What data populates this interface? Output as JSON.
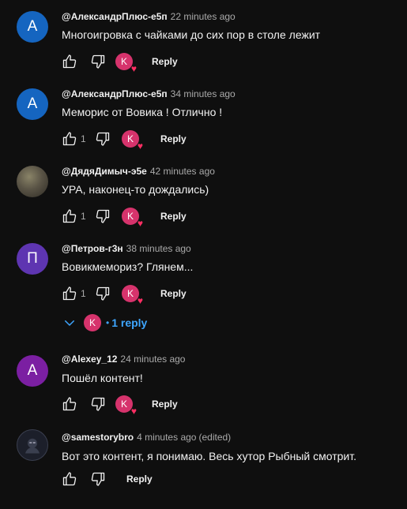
{
  "colors": {
    "background": "#0f0f0f",
    "text": "#f1f1f1",
    "secondary_text": "#aaaaaa",
    "link": "#3ea6ff",
    "heart": "#ff2e63",
    "creator_avatar": "#d6336c"
  },
  "comments": [
    {
      "author": "@АлександрПлюс-е5п",
      "time": "22 minutes ago",
      "text": "Многоигровка с чайками до сих пор в столе лежит",
      "likes": "",
      "avatar_letter": "А",
      "avatar_color": "#1565c0",
      "hearted": true,
      "creator_letter": "K",
      "reply_label": "Reply"
    },
    {
      "author": "@АлександрПлюс-е5п",
      "time": "34 minutes ago",
      "text": "Меморис от Вовика ! Отлично !",
      "likes": "1",
      "avatar_letter": "А",
      "avatar_color": "#1565c0",
      "hearted": true,
      "creator_letter": "K",
      "reply_label": "Reply"
    },
    {
      "author": "@ДядяДимыч-э5е",
      "time": "42 minutes ago",
      "text": "УРА, наконец-то дождались)",
      "likes": "1",
      "avatar_letter": "",
      "avatar_color": "#5a5446",
      "hearted": true,
      "creator_letter": "K",
      "reply_label": "Reply"
    },
    {
      "author": "@Петров-г3н",
      "time": "38 minutes ago",
      "text": "Вовикмемориз? Глянем...",
      "likes": "1",
      "avatar_letter": "П",
      "avatar_color": "#5e35b1",
      "hearted": true,
      "creator_letter": "K",
      "reply_label": "Reply"
    },
    {
      "author": "@Alexey_12",
      "time": "24 minutes ago",
      "text": "Пошёл контент!",
      "likes": "",
      "avatar_letter": "A",
      "avatar_color": "#7b1fa2",
      "hearted": true,
      "creator_letter": "K",
      "reply_label": "Reply"
    },
    {
      "author": "@samestorybro",
      "time": "4 minutes ago",
      "edited": "(edited)",
      "text": "Вот это контент, я понимаю. Весь хутор Рыбный смотрит.",
      "likes": "",
      "avatar_letter": "",
      "avatar_color": "#1c1f2a",
      "hearted": false,
      "reply_label": "Reply"
    }
  ],
  "replies_toggle": {
    "creator_letter": "K",
    "separator": "•",
    "label": "1 reply"
  }
}
